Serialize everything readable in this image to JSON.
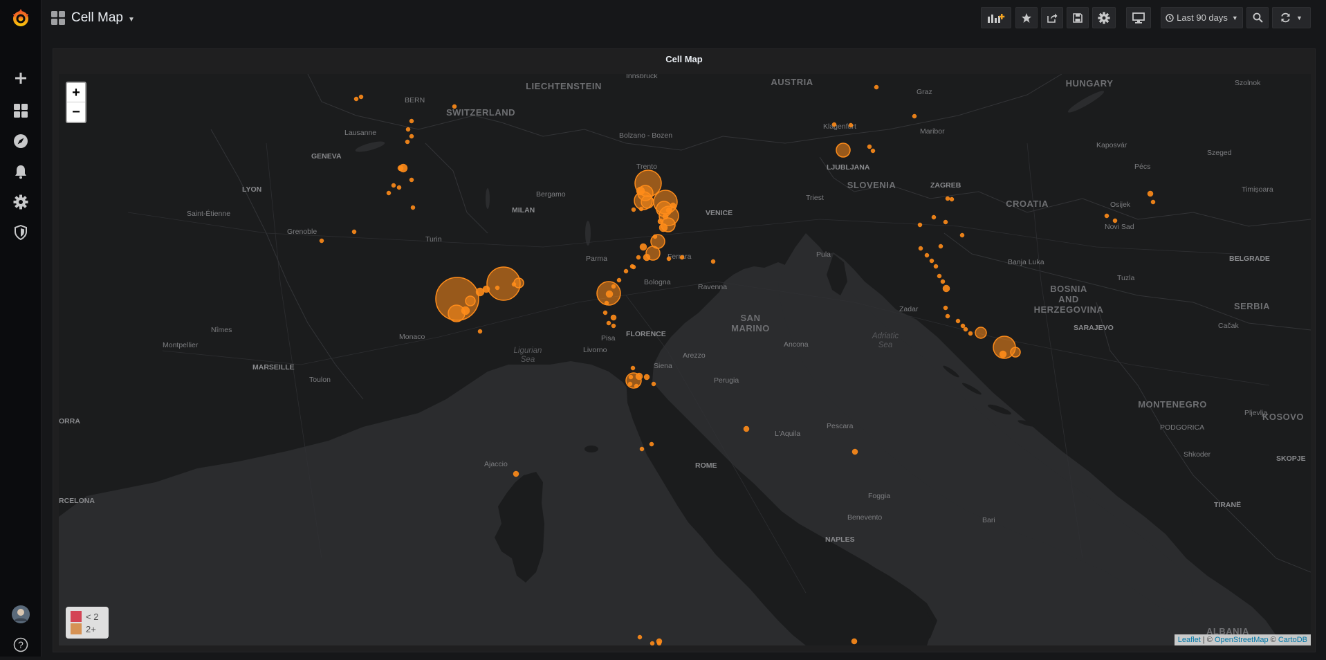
{
  "app": {
    "brand_color": "#f05a28"
  },
  "sidebar": {
    "items": [
      {
        "icon": "plus-icon"
      },
      {
        "icon": "dashboards-icon"
      },
      {
        "icon": "explore-icon"
      },
      {
        "icon": "bell-icon"
      },
      {
        "icon": "gear-icon"
      },
      {
        "icon": "shield-icon"
      }
    ],
    "help_label": "?"
  },
  "header": {
    "title": "Cell Map",
    "time_range": "Last 90 days"
  },
  "panel": {
    "title": "Cell Map"
  },
  "map": {
    "zoom_in": "+",
    "zoom_out": "−",
    "marker_color": "#ff8c1a",
    "legend": [
      {
        "label": "< 2",
        "color": "#f2495c"
      },
      {
        "label": "2+",
        "color": "#f4a45b"
      }
    ],
    "attribution": {
      "leaflet": "Leaflet",
      "sep1": " | © ",
      "osm": "OpenStreetMap",
      "sep2": " © ",
      "carto": "CartoDB"
    },
    "countries": [
      "LIECHTENSTEIN",
      "AUSTRIA",
      "HUNGARY",
      "SWITZERLAND",
      "SLOVENIA",
      "CROATIA",
      "BOSNIA",
      "AND",
      "HERZEGOVINA",
      "SERBIA",
      "SAN",
      "MARINO",
      "MONTENEGRO",
      "KOSOVO",
      "ALBANIA"
    ],
    "cities": [
      "Innsbruck",
      "BERN",
      "Graz",
      "Szolnok",
      "Klagenfurt",
      "Maribor",
      "Lausanne",
      "Bolzano - Bozen",
      "Kaposvár",
      "GENEVA",
      "LJUBLJANA",
      "Szeged",
      "Trento",
      "Pécs",
      "ZAGREB",
      "Bergamo",
      "LYON",
      "Triest",
      "Timișoara",
      "Osijek",
      "MILAN",
      "VENICE",
      "Saint-Étienne",
      "Grenoble",
      "Novi Sad",
      "Turin",
      "Pula",
      "Banja Luka",
      "BELGRADE",
      "Ferrara",
      "Parma",
      "Bologna",
      "Tuzla",
      "Ravenna",
      "Zadar",
      "SARAJEVO",
      "Nîmes",
      "Monaco",
      "FLORENCE",
      "Cačak",
      "Montpellier",
      "Pisa",
      "Livorno",
      "Ancona",
      "Arezzo",
      "MARSEILLE",
      "Toulon",
      "Siena",
      "Perugia",
      "Pljevlja",
      "PODGORICA",
      "L'Aquila",
      "Shkoder",
      "Pescara",
      "SKOPJE",
      "ROME",
      "Ajaccio",
      "Foggia",
      "TIRANË",
      "Benevento",
      "Bari",
      "NAPLES",
      "RCELONA",
      "ORRA",
      "Kosovo"
    ],
    "seas": [
      "Ligurian",
      "Sea",
      "Adriatic",
      "Sea"
    ]
  }
}
